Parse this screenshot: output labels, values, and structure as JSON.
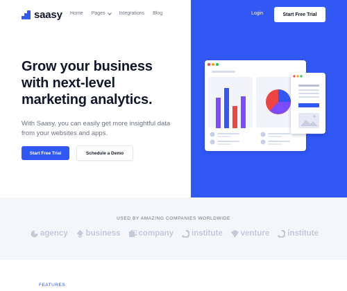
{
  "brand": {
    "name": "saasy",
    "accent": "#3157f5"
  },
  "nav": {
    "items": [
      {
        "label": "Home",
        "has_dropdown": false
      },
      {
        "label": "Pages",
        "has_dropdown": true
      },
      {
        "label": "Integrations",
        "has_dropdown": false
      },
      {
        "label": "Blog",
        "has_dropdown": false
      }
    ]
  },
  "header": {
    "login_label": "Login",
    "trial_label": "Start Free Trial"
  },
  "hero": {
    "headline_lines": [
      "Grow your business",
      "with next-level",
      "marketing analytics."
    ],
    "subtext": "With Saasy, you can easily get more insightful data from your websites and apps.",
    "primary_cta": "Start Free Trial",
    "secondary_cta": "Schedule a Demo"
  },
  "illustration": {
    "bar_colors": [
      "#7c4dff",
      "#3157f5",
      "#ef4444",
      "#7c4dff"
    ],
    "pie_colors": [
      "#ef4444",
      "#7c4dff",
      "#3157f5"
    ],
    "window_dot_colors": [
      "#ef4444",
      "#f59e0b",
      "#22c55e"
    ]
  },
  "logos": {
    "title": "USED BY AMAZING COMPANIES WORLDWIDE",
    "companies": [
      {
        "name": "agency",
        "icon": "agency-icon"
      },
      {
        "name": "business",
        "icon": "business-icon"
      },
      {
        "name": "company",
        "icon": "company-icon"
      },
      {
        "name": "institute",
        "icon": "institute-icon"
      },
      {
        "name": "venture",
        "icon": "venture-icon"
      },
      {
        "name": "institute",
        "icon": "institute-icon"
      }
    ]
  },
  "features": {
    "label": "FEATURES"
  }
}
